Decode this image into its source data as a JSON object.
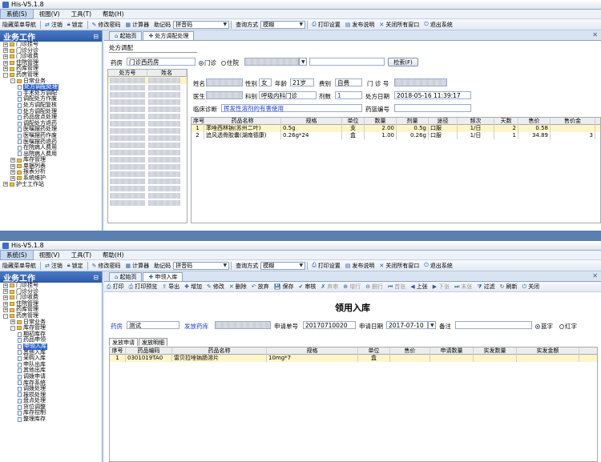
{
  "title": "His-V5.1.8",
  "menu": [
    "系统(S)",
    "视图(V)",
    "工具(T)",
    "帮助(H)"
  ],
  "toolbar": {
    "hide_nav": "隐藏菜单导航",
    "logout": "注销",
    "lock": "锁定",
    "change_pwd": "修改密码",
    "calculator": "计算器",
    "notepad": "助记码",
    "input_method": "拼音码",
    "query_mode_label": "查询方式",
    "query_mode": "模糊",
    "print_settings": "打印设置",
    "release_notes": "发布说明",
    "close_all": "关闭所有窗口",
    "exit": "退出系统"
  },
  "sidebar": {
    "header": "业务工作",
    "tree1": [
      {
        "label": "门诊挂号",
        "level": 1,
        "toggle": "+"
      },
      {
        "label": "门诊分诊",
        "level": 1,
        "toggle": "+"
      },
      {
        "label": "门诊收费",
        "level": 1,
        "toggle": "+"
      },
      {
        "label": "住院管理",
        "level": 1,
        "toggle": "+"
      },
      {
        "label": "药库管理",
        "level": 1,
        "toggle": "+"
      },
      {
        "label": "药房管理",
        "level": 1,
        "toggle": "-"
      },
      {
        "label": "日常业务",
        "level": 2,
        "toggle": "-"
      },
      {
        "label": "处方调配处理",
        "level": 3,
        "selected": true
      },
      {
        "label": "手术处方调配",
        "level": 3
      },
      {
        "label": "调配处方作废",
        "level": 3
      },
      {
        "label": "处方调配复核",
        "level": 3
      },
      {
        "label": "处方调配处理",
        "level": 3
      },
      {
        "label": "药品盘点处理",
        "level": 3
      },
      {
        "label": "调配处方退药",
        "level": 3
      },
      {
        "label": "医嘱摆药处理",
        "level": 3
      },
      {
        "label": "医嘱摆药作废",
        "level": 3
      },
      {
        "label": "医嘱摆药退药",
        "level": 3
      },
      {
        "label": "在院病人费用",
        "level": 3
      },
      {
        "label": "出院病人费用",
        "level": 3
      },
      {
        "label": "库存管理",
        "level": 2,
        "toggle": "+"
      },
      {
        "label": "单据列表",
        "level": 2,
        "toggle": "+"
      },
      {
        "label": "报表分析",
        "level": 2,
        "toggle": "+"
      },
      {
        "label": "系统维护",
        "level": 2,
        "toggle": "+"
      },
      {
        "label": "护士工作站",
        "level": 1,
        "toggle": "+"
      }
    ],
    "tree2": [
      {
        "label": "门诊挂号",
        "level": 1,
        "toggle": "+"
      },
      {
        "label": "门诊分诊",
        "level": 1,
        "toggle": "+"
      },
      {
        "label": "门诊收费",
        "level": 1,
        "toggle": "+"
      },
      {
        "label": "住院管理",
        "level": 1,
        "toggle": "+"
      },
      {
        "label": "药库管理",
        "level": 1,
        "toggle": "+"
      },
      {
        "label": "药房管理",
        "level": 1,
        "toggle": "-"
      },
      {
        "label": "日常业务",
        "level": 2,
        "toggle": "+"
      },
      {
        "label": "库存管理",
        "level": 2,
        "toggle": "-"
      },
      {
        "label": "期初库存",
        "level": 3
      },
      {
        "label": "药品申领",
        "level": 3
      },
      {
        "label": "申领入库",
        "level": 3,
        "selected": true
      },
      {
        "label": "其他入库",
        "level": 3
      },
      {
        "label": "采购入库",
        "level": 3
      },
      {
        "label": "申队出库",
        "level": 3
      },
      {
        "label": "其他出库",
        "level": 3
      },
      {
        "label": "调拨申请",
        "level": 3
      },
      {
        "label": "库存系统",
        "level": 3
      },
      {
        "label": "调拨处理",
        "level": 3
      },
      {
        "label": "报损处理",
        "level": 3
      },
      {
        "label": "盘点处理",
        "level": 3
      },
      {
        "label": "货位调整",
        "level": 3
      },
      {
        "label": "库存控制",
        "level": 3
      },
      {
        "label": "整理库存",
        "level": 3
      }
    ]
  },
  "w1": {
    "tabs": [
      "起始页",
      "处方调配处理"
    ],
    "group": "处方调配",
    "pharmacy_label": "药房",
    "pharmacy": "门诊西药房",
    "radio_outpatient": "门诊",
    "radio_inpatient": "住院",
    "search_btn": "检索(F)",
    "list_headers": [
      "处方号",
      "姓名"
    ],
    "patient": {
      "name_label": "姓名",
      "sex_label": "性别",
      "sex": "女",
      "age_label": "年龄",
      "age": "21岁",
      "fee_label": "费别",
      "fee": "自费",
      "clinic_no_label": "门 诊 号",
      "doctor_label": "医生",
      "dept_label": "科别",
      "dept": "呼吸内科门诊",
      "doses_label": "剂数",
      "doses": "1",
      "date_label": "处方日期",
      "date": "2018-05-16 11:39:17",
      "diag_label": "临床诊断",
      "diag": "挥发性溶剂的有害使用",
      "basket_label": "药篮编号"
    },
    "grid_headers": [
      "序号",
      "药品名称",
      "规格",
      "单位",
      "数量",
      "剂量",
      "途径",
      "频次",
      "天数",
      "售价",
      "售价金"
    ],
    "rows": [
      [
        "1",
        "苯唑西林钠(苏州二叶)",
        "0.5g",
        "支",
        "2.00",
        "0.5g",
        "口服",
        "1/日",
        "2",
        "0.58",
        ""
      ],
      [
        "2",
        "追风透骨胶囊(湖南德康)",
        "0.26g*24",
        "盒",
        "1.00",
        "0.26g",
        "口服",
        "1/日",
        "1",
        "34.89",
        "3"
      ]
    ]
  },
  "w2": {
    "tabs": [
      "起始页",
      "申领入库"
    ],
    "toolbar": [
      "打印",
      "打印预览",
      "导出",
      "增加",
      "修改",
      "删除",
      "放弃",
      "保存",
      "审核",
      "弃审",
      "增行",
      "删行",
      "首张",
      "上张",
      "下张",
      "末张",
      "过滤",
      "刷新",
      "关闭"
    ],
    "form_title": "领用入库",
    "pharmacy_label": "药房",
    "pharmacy": "测试",
    "send_label": "发放药库",
    "apply_no_label": "申请单号",
    "apply_no": "20170710020",
    "apply_date_label": "申请日期",
    "apply_date": "2017-07-10",
    "remark_label": "备注",
    "blue_word": "蓝字",
    "red_word": "红字",
    "subtabs": [
      "发放申请",
      "发放明细"
    ],
    "grid_headers": [
      "序号",
      "药品编码",
      "药品名称",
      "规格",
      "单位",
      "售价",
      "申请数量",
      "实发数量",
      "实发金额"
    ],
    "rows": [
      [
        "1",
        "0301019TA0",
        "雷贝拉唑钠肠溶片",
        "10mg*7",
        "盒",
        "",
        "",
        "",
        ""
      ]
    ]
  }
}
